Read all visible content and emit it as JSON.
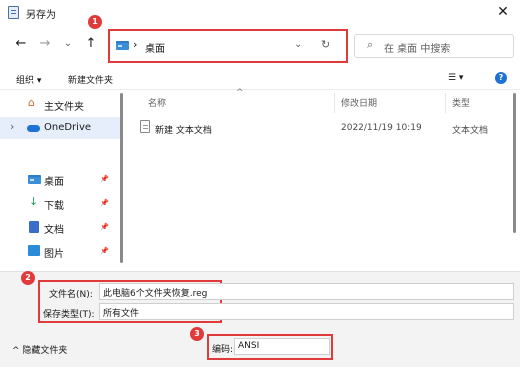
{
  "window": {
    "title": "另存为",
    "close_glyph": "✕"
  },
  "nav": {
    "back_glyph": "←",
    "forward_glyph": "→",
    "recent_glyph": "⌄",
    "up_glyph": "↑",
    "address_chevron": "›",
    "address_path": "桌面",
    "address_dropdown_glyph": "⌄",
    "refresh_glyph": "↻",
    "search_glyph": "⌕",
    "search_placeholder": "在 桌面 中搜索"
  },
  "badges": {
    "b1": "1",
    "b2": "2",
    "b3": "3"
  },
  "toolbar": {
    "organize_label": "组织 ▾",
    "new_folder_label": "新建文件夹",
    "view_glyph": "☰ ▾",
    "help_glyph": "?"
  },
  "sidebar": {
    "items": [
      {
        "label": "主文件夹",
        "icon": "home-icon",
        "chevron": ""
      },
      {
        "label": "OneDrive",
        "icon": "cloud-icon",
        "chevron": "›"
      },
      {
        "label": "桌面",
        "icon": "desktop-icon",
        "pin": "📌"
      },
      {
        "label": "下载",
        "icon": "download-icon",
        "pin": "📌"
      },
      {
        "label": "文档",
        "icon": "document-icon",
        "pin": "📌"
      },
      {
        "label": "图片",
        "icon": "image-icon",
        "pin": "📌"
      }
    ]
  },
  "list": {
    "sort_glyph": "^",
    "columns": [
      "名称",
      "修改日期",
      "类型"
    ],
    "rows": [
      {
        "name": "新建 文本文档",
        "modified": "2022/11/19 10:19",
        "type": "文本文档"
      }
    ]
  },
  "form": {
    "filename_label": "文件名(N):",
    "filename_value": "此电脑6个文件夹恢复.reg",
    "filetype_label": "保存类型(T):",
    "filetype_value": "所有文件",
    "encoding_label": "编码:",
    "encoding_value": "ANSI",
    "hide_folders_label": "^ 隐藏文件夹"
  },
  "colors": {
    "accent": "#1e72d6",
    "highlight_red": "#e13a3a",
    "selected_bg": "#e5eefa"
  }
}
